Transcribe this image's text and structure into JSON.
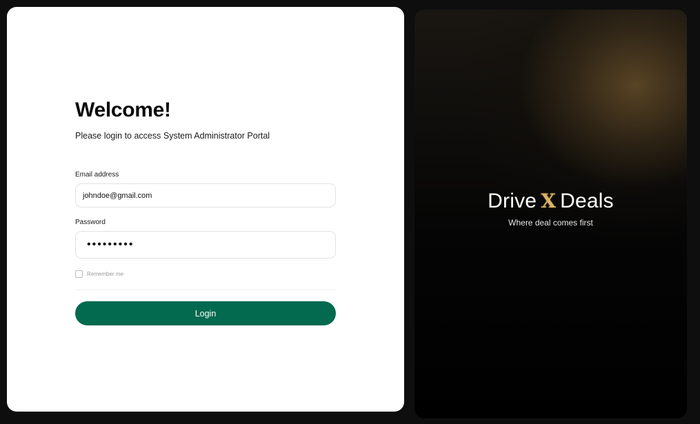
{
  "login": {
    "title": "Welcome!",
    "subtitle": "Please login to access System Administrator Portal",
    "email_label": "Email address",
    "email_value": "johndoe@gmail.com",
    "password_label": "Password",
    "password_value": "•••••••••",
    "remember_label": "Remember me",
    "remember_checked": false,
    "login_button": "Login"
  },
  "brand": {
    "name_left": "Drive",
    "name_x": "X",
    "name_right": "Deals",
    "tagline": "Where deal comes first"
  },
  "colors": {
    "primary_button": "#036a4f",
    "brand_accent": "#d9b46a"
  }
}
